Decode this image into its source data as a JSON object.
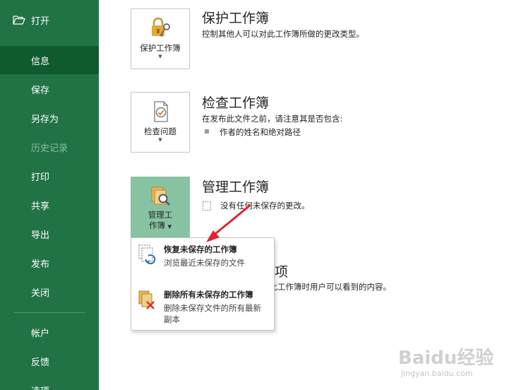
{
  "sidebar": {
    "open": "打开",
    "items": [
      {
        "label": "信息",
        "state": "active"
      },
      {
        "label": "保存",
        "state": "normal"
      },
      {
        "label": "另存为",
        "state": "normal"
      },
      {
        "label": "历史记录",
        "state": "disabled"
      },
      {
        "label": "打印",
        "state": "normal"
      },
      {
        "label": "共享",
        "state": "normal"
      },
      {
        "label": "导出",
        "state": "normal"
      },
      {
        "label": "发布",
        "state": "normal"
      },
      {
        "label": "关闭",
        "state": "normal"
      },
      {
        "label": "帐户",
        "state": "normal"
      },
      {
        "label": "反馈",
        "state": "normal"
      },
      {
        "label": "选项",
        "state": "normal"
      }
    ]
  },
  "protect": {
    "button_label": "保护工作簿",
    "title": "保护工作簿",
    "desc": "控制其他人可以对此工作簿所做的更改类型。",
    "icon": "lock-key-icon"
  },
  "inspect": {
    "button_label": "检查问题",
    "title": "检查工作簿",
    "desc": "在发布此文件之前，请注意其是否包含:",
    "bullets": [
      "作者的姓名和绝对路径"
    ],
    "icon": "inspect-document-icon"
  },
  "manage": {
    "button_label_line1": "管理工",
    "button_label_line2": "作簿",
    "title": "管理工作簿",
    "desc": "没有任何未保存的更改。",
    "icon": "manage-workbook-icon"
  },
  "properties_partial": {
    "title_visible": "选项",
    "desc_visible": "置此工作簿时用户可以看到的内容。"
  },
  "dropdown": {
    "items": [
      {
        "title": "恢复未保存的工作簿",
        "desc": "浏览最近未保存的文件",
        "icon": "recover-workbook-icon"
      },
      {
        "title": "删除所有未保存的工作簿",
        "desc": "删除未保存文件的所有最新副本",
        "icon": "delete-workbooks-icon"
      }
    ]
  },
  "watermark": {
    "text": "Baidu经验",
    "sub": "jingyan.baidu.com"
  },
  "colors": {
    "sidebar": "#217346",
    "active": "#0f5a2f",
    "accent_button": "#87c3a2",
    "arrow": "#e0242e"
  }
}
